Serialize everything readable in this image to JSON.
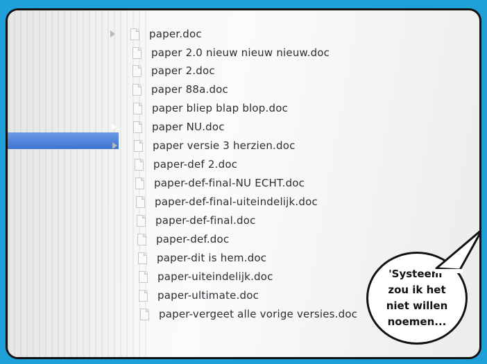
{
  "files": [
    {
      "name": "paper.doc",
      "selected": false,
      "has_disclosure": true
    },
    {
      "name": "paper 2.0 nieuw nieuw nieuw.doc",
      "selected": false,
      "has_disclosure": false
    },
    {
      "name": "paper 2.doc",
      "selected": false,
      "has_disclosure": false
    },
    {
      "name": "paper 88a.doc",
      "selected": false,
      "has_disclosure": false
    },
    {
      "name": "paper bliep blap blop.doc",
      "selected": false,
      "has_disclosure": false
    },
    {
      "name": "paper NU.doc",
      "selected": true,
      "has_disclosure": true
    },
    {
      "name": "paper versie 3 herzien.doc",
      "selected": false,
      "has_disclosure": true
    },
    {
      "name": "paper-def 2.doc",
      "selected": false,
      "has_disclosure": false
    },
    {
      "name": "paper-def-final-NU ECHT.doc",
      "selected": false,
      "has_disclosure": false
    },
    {
      "name": "paper-def-final-uiteindelijk.doc",
      "selected": false,
      "has_disclosure": false
    },
    {
      "name": "paper-def-final.doc",
      "selected": false,
      "has_disclosure": false
    },
    {
      "name": "paper-def.doc",
      "selected": false,
      "has_disclosure": false
    },
    {
      "name": "paper-dit is hem.doc",
      "selected": false,
      "has_disclosure": false
    },
    {
      "name": "paper-uiteindelijk.doc",
      "selected": false,
      "has_disclosure": false
    },
    {
      "name": "paper-ultimate.doc",
      "selected": false,
      "has_disclosure": false
    },
    {
      "name": "paper-vergeet alle vorige versies.doc",
      "selected": false,
      "has_disclosure": false
    }
  ],
  "speech_bubble": {
    "lines": [
      "'Systeem'",
      "zou ik het",
      "niet willen",
      "noemen..."
    ]
  },
  "colors": {
    "background": "#1fa0d8",
    "selection": "#3d73d2",
    "text": "#2c2c34"
  }
}
